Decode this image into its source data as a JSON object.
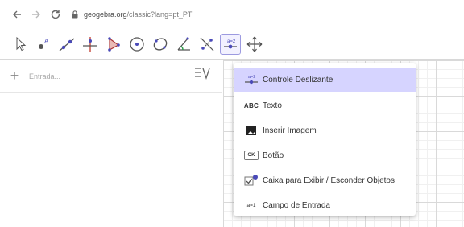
{
  "browser": {
    "back_icon": "arrow-left-icon",
    "forward_icon": "arrow-right-icon",
    "reload_icon": "reload-icon",
    "url_host": "geogebra.org",
    "url_path": "/classic?lang=pt_PT"
  },
  "toolbar": {
    "tools": [
      {
        "name": "move-tool",
        "icon": "arrow-pointer-icon"
      },
      {
        "name": "point-tool",
        "icon": "point-icon"
      },
      {
        "name": "line-tool",
        "icon": "line-through-points-icon"
      },
      {
        "name": "perpendicular-line-tool",
        "icon": "perpendicular-icon"
      },
      {
        "name": "polygon-tool",
        "icon": "polygon-icon"
      },
      {
        "name": "circle-tool",
        "icon": "circle-center-point-icon"
      },
      {
        "name": "conic-tool",
        "icon": "ellipse-icon"
      },
      {
        "name": "angle-tool",
        "icon": "angle-icon"
      },
      {
        "name": "reflect-tool",
        "icon": "reflect-line-icon"
      },
      {
        "name": "slider-tool",
        "icon": "slider-icon",
        "selected": true
      },
      {
        "name": "move-graphics-view-tool",
        "icon": "move-cross-icon"
      }
    ]
  },
  "algebra": {
    "plus": "+",
    "input_placeholder": "Entrada...",
    "menu_icon": "algebra-menu-icon"
  },
  "submenu": {
    "items": [
      {
        "label": "Controle Deslizante",
        "icon": "slider-icon",
        "active": true
      },
      {
        "label": "Texto",
        "icon": "text-icon",
        "icon_text": "ABC"
      },
      {
        "label": "Inserir Imagem",
        "icon": "image-icon"
      },
      {
        "label": "Botão",
        "icon": "button-icon",
        "icon_text": "OK"
      },
      {
        "label": "Caixa para Exibir / Esconder Objetos",
        "icon": "checkbox-icon"
      },
      {
        "label": "Campo de Entrada",
        "icon": "input-box-icon",
        "icon_text": "a=1"
      }
    ]
  },
  "colors": {
    "accent": "#6557d2",
    "selected_bg": "#d6d4ff",
    "icon_fill": "#9997d4"
  }
}
